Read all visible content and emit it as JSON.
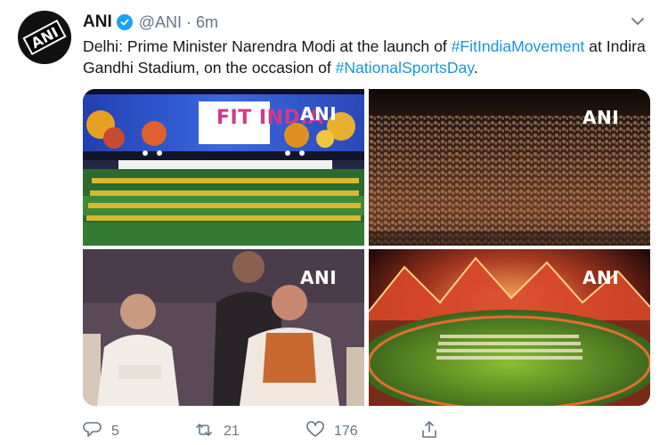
{
  "tweet": {
    "display_name": "ANI",
    "handle": "@ANI",
    "separator": "·",
    "time": "6m",
    "avatar_text": "ANI",
    "text_parts": {
      "p1": "Delhi: Prime Minister Narendra Modi at the launch of ",
      "h1": "#FitIndiaMovement",
      "p2": " at Indira Gandhi Stadium, on the occasion of ",
      "h2": "#NationalSportsDay",
      "p3": "."
    },
    "photos": [
      {
        "watermark": "ANI",
        "stage_text": "FIT INDIA"
      },
      {
        "watermark": "ANI"
      },
      {
        "watermark": "ANI"
      },
      {
        "watermark": "ANI"
      }
    ],
    "actions": {
      "replies": "5",
      "retweets": "21",
      "likes": "176"
    },
    "icons": {
      "verified": "verified-badge-icon",
      "caret": "chevron-down-icon",
      "reply": "reply-icon",
      "retweet": "retweet-icon",
      "like": "heart-icon",
      "share": "share-icon"
    },
    "colors": {
      "link": "#1b95e0",
      "muted": "#657786",
      "verified": "#1da1f2"
    }
  }
}
